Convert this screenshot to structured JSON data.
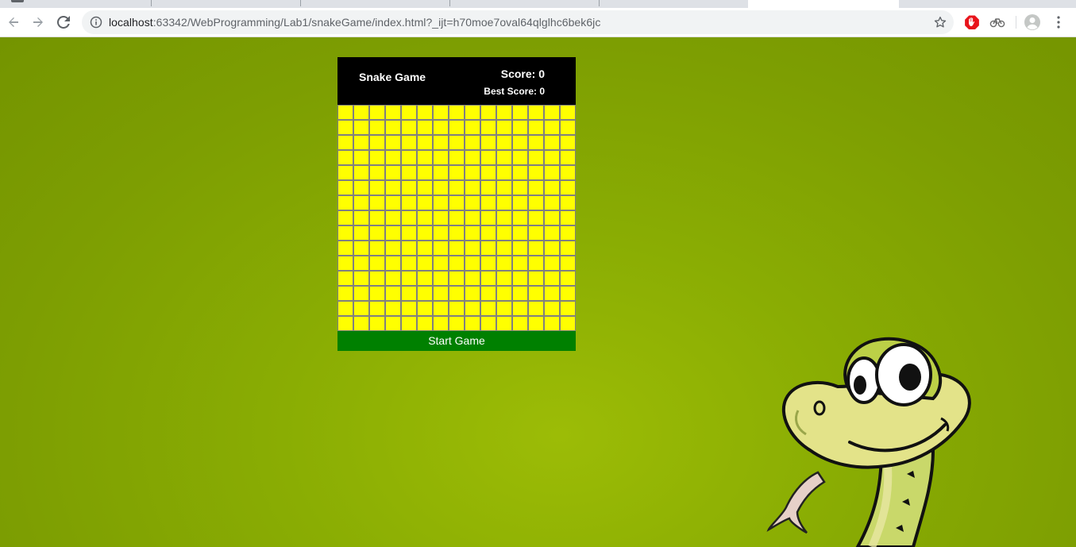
{
  "browser": {
    "url_host": "localhost",
    "url_rest": ":63342/WebProgramming/Lab1/snakeGame/index.html?_ijt=h70moe7oval64qlglhc6bek6jc",
    "icons": {
      "back": "back-arrow-icon",
      "forward": "forward-arrow-icon",
      "reload": "reload-icon",
      "info": "info-icon",
      "bookmark": "star-icon",
      "adblock": "adblock-icon",
      "extension": "extension-icon",
      "profile": "profile-avatar-icon",
      "menu": "kebab-menu-icon"
    }
  },
  "game": {
    "title": "Snake Game",
    "score_label": "Score: 0",
    "best_score_label": "Best Score: 0",
    "start_button": "Start Game",
    "grid": {
      "columns": 15,
      "rows": 15
    },
    "colors": {
      "header_bg": "#000000",
      "header_text": "#ffffff",
      "cell_bg": "#ffff00",
      "cell_border": "#808080",
      "button_bg": "#008000",
      "page_bg": "#8aad03"
    }
  },
  "decor": {
    "mascot": "cartoon-snake-illustration"
  }
}
